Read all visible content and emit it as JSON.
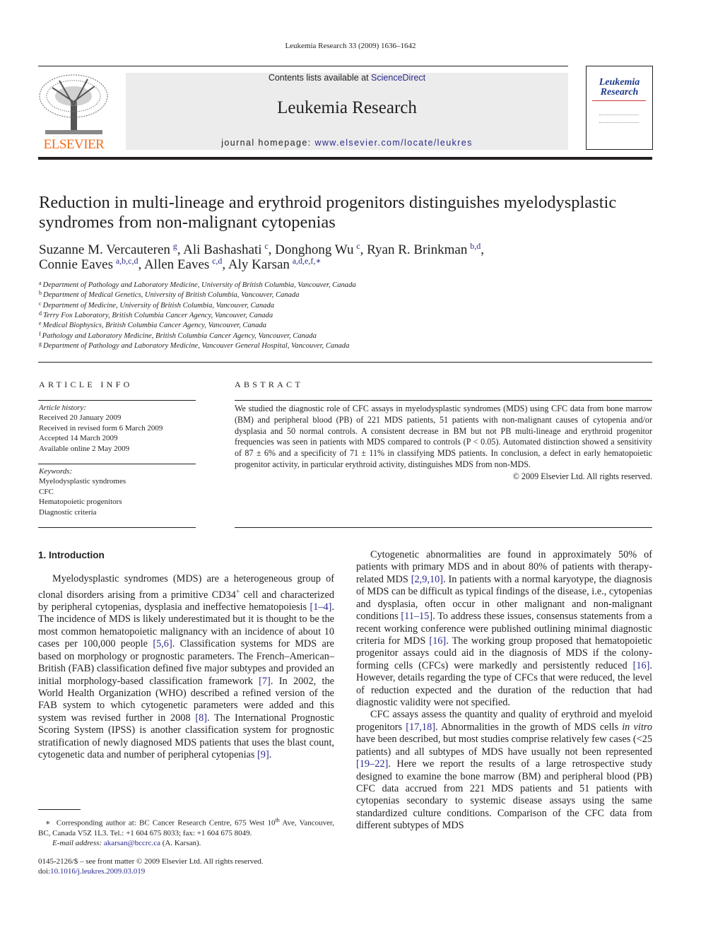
{
  "header": {
    "running_head": "Leukemia Research 33 (2009) 1636–1642",
    "publisher_logo": "ELSEVIER",
    "contents_prefix": "Contents lists available at ",
    "contents_link": "ScienceDirect",
    "journal_title": "Leukemia Research",
    "homepage_prefix": "journal homepage: ",
    "homepage_link": "www.elsevier.com/locate/leukres",
    "cover_title": "Leukemia Research",
    "colors": {
      "elsevier_orange": "#f06e1e",
      "link_blue": "#2a2a8c",
      "banner_gray": "#ececec"
    }
  },
  "article": {
    "title": "Reduction in multi-lineage and erythroid progenitors distinguishes myelodysplastic syndromes from non-malignant cytopenias",
    "authors": [
      {
        "name": "Suzanne M. Vercauteren",
        "aff": "g",
        "sep": ", "
      },
      {
        "name": "Ali Bashashati",
        "aff": "c",
        "sep": ", "
      },
      {
        "name": "Donghong Wu",
        "aff": "c",
        "sep": ", "
      },
      {
        "name": "Ryan R. Brinkman",
        "aff": "b,d",
        "sep": ","
      },
      {
        "name": "Connie Eaves",
        "aff": "a,b,c,d",
        "sep": ", "
      },
      {
        "name": "Allen Eaves",
        "aff": "c,d",
        "sep": ", "
      },
      {
        "name": "Aly Karsan",
        "aff": "a,d,e,f,∗",
        "sep": ""
      }
    ],
    "affiliations": [
      {
        "key": "a",
        "text": "Department of Pathology and Laboratory Medicine, University of British Columbia, Vancouver, Canada"
      },
      {
        "key": "b",
        "text": "Department of Medical Genetics, University of British Columbia, Vancouver, Canada"
      },
      {
        "key": "c",
        "text": "Department of Medicine, University of British Columbia, Vancouver, Canada"
      },
      {
        "key": "d",
        "text": "Terry Fox Laboratory, British Columbia Cancer Agency, Vancouver, Canada"
      },
      {
        "key": "e",
        "text": "Medical Biophysics, British Columbia Cancer Agency, Vancouver, Canada"
      },
      {
        "key": "f",
        "text": "Pathology and Laboratory Medicine, British Columbia Cancer Agency, Vancouver, Canada"
      },
      {
        "key": "g",
        "text": "Department of Pathology and Laboratory Medicine, Vancouver General Hospital, Vancouver, Canada"
      }
    ]
  },
  "article_info": {
    "heading": "ARTICLE INFO",
    "history_label": "Article history:",
    "history": [
      "Received 20 January 2009",
      "Received in revised form 6 March 2009",
      "Accepted 14 March 2009",
      "Available online 2 May 2009"
    ],
    "keywords_label": "Keywords:",
    "keywords": [
      "Myelodysplastic syndromes",
      "CFC",
      "Hematopoietic progenitors",
      "Diagnostic criteria"
    ]
  },
  "abstract": {
    "heading": "ABSTRACT",
    "text": "We studied the diagnostic role of CFC assays in myelodysplastic syndromes (MDS) using CFC data from bone marrow (BM) and peripheral blood (PB) of 221 MDS patients, 51 patients with non-malignant causes of cytopenia and/or dysplasia and 50 normal controls. A consistent decrease in BM but not PB multi-lineage and erythroid progenitor frequencies was seen in patients with MDS compared to controls (P < 0.05). Automated distinction showed a sensitivity of 87 ± 6% and a specificity of 71 ± 11% in classifying MDS patients. In conclusion, a defect in early hematopoietic progenitor activity, in particular erythroid activity, distinguishes MDS from non-MDS.",
    "copyright": "© 2009 Elsevier Ltd. All rights reserved."
  },
  "body": {
    "section_heading": "1.  Introduction",
    "left_paragraphs": [
      [
        {
          "t": "Myelodysplastic syndromes (MDS) are a heterogeneous group of clonal disorders arising from a primitive CD34"
        },
        {
          "t": "+",
          "sup": true
        },
        {
          "t": " cell and characterized by peripheral cytopenias, dysplasia and ineffective hematopoiesis "
        },
        {
          "t": "[1–4]",
          "ref": true
        },
        {
          "t": ". The incidence of MDS is likely underestimated but it is thought to be the most common hematopoietic malignancy with an incidence of about 10 cases per 100,000 people "
        },
        {
          "t": "[5,6]",
          "ref": true
        },
        {
          "t": ". Classification systems for MDS are based on morphology or prognostic parameters. The French–American–British (FAB) classification defined five major subtypes and provided an initial morphology-based classification framework "
        },
        {
          "t": "[7]",
          "ref": true
        },
        {
          "t": ". In 2002, the World Health Organization (WHO) described a refined version of the FAB system to which cytogenetic parameters were added and this system was revised further in 2008 "
        },
        {
          "t": "[8]",
          "ref": true
        },
        {
          "t": ". The International Prognostic Scoring System (IPSS) is another classification system for prognostic stratification of newly diagnosed MDS patients that uses the blast count, cytogenetic data and number of peripheral cytopenias "
        },
        {
          "t": "[9]",
          "ref": true
        },
        {
          "t": "."
        }
      ]
    ],
    "right_paragraphs": [
      [
        {
          "t": "Cytogenetic abnormalities are found in approximately 50% of patients with primary MDS and in about 80% of patients with therapy-related MDS "
        },
        {
          "t": "[2,9,10]",
          "ref": true
        },
        {
          "t": ". In patients with a normal karyotype, the diagnosis of MDS can be difficult as typical findings of the disease, i.e., cytopenias and dysplasia, often occur in other malignant and non-malignant conditions "
        },
        {
          "t": "[11–15]",
          "ref": true
        },
        {
          "t": ". To address these issues, consensus statements from a recent working conference were published outlining minimal diagnostic criteria for MDS "
        },
        {
          "t": "[16]",
          "ref": true
        },
        {
          "t": ". The working group proposed that hematopoietic progenitor assays could aid in the diagnosis of MDS if the colony-forming cells (CFCs) were markedly and persistently reduced "
        },
        {
          "t": "[16]",
          "ref": true
        },
        {
          "t": ". However, details regarding the type of CFCs that were reduced, the level of reduction expected and the duration of the reduction that had diagnostic validity were not specified."
        }
      ],
      [
        {
          "t": "CFC assays assess the quantity and quality of erythroid and myeloid progenitors "
        },
        {
          "t": "[17,18]",
          "ref": true
        },
        {
          "t": ". Abnormalities in the growth of MDS cells "
        },
        {
          "t": "in vitro",
          "i": true
        },
        {
          "t": " have been described, but most studies comprise relatively few cases (<25 patients) and all subtypes of MDS have usually not been represented "
        },
        {
          "t": "[19–22]",
          "ref": true
        },
        {
          "t": ". Here we report the results of a large retrospective study designed to examine the bone marrow (BM) and peripheral blood (PB) CFC data accrued from 221 MDS patients and 51 patients with cytopenias secondary to systemic disease assays using the same standardized culture conditions. Comparison of the CFC data from different subtypes of MDS"
        }
      ]
    ]
  },
  "footnote": {
    "star": "∗",
    "corresponding_pre": "Corresponding author at: BC Cancer Research Centre, 675 West 10",
    "corresponding_sup": "th",
    "corresponding_post": " Ave, Vancouver, BC, Canada V5Z 1L3. Tel.: +1 604 675 8033; fax: +1 604 675 8049.",
    "email_label": "E-mail address:",
    "email": "akarsan@bccrc.ca",
    "email_name": " (A. Karsan).",
    "front_matter": "0145-2126/$ – see front matter © 2009 Elsevier Ltd. All rights reserved.",
    "doi_label": "doi:",
    "doi": "10.1016/j.leukres.2009.03.019"
  }
}
